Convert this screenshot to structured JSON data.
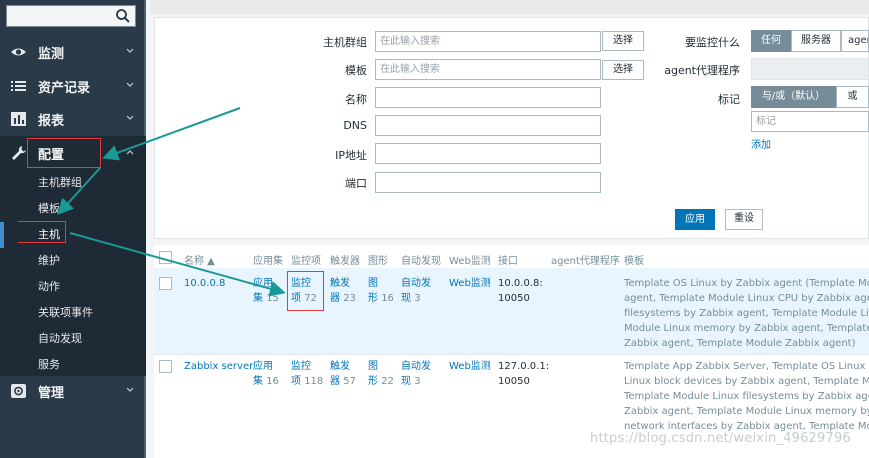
{
  "sidebar": {
    "search": {
      "value": "",
      "placeholder": ""
    },
    "menu": [
      {
        "label": "监测",
        "icon": "eye-icon"
      },
      {
        "label": "资产记录",
        "icon": "list-icon"
      },
      {
        "label": "报表",
        "icon": "bar-chart-icon"
      },
      {
        "label": "配置",
        "icon": "wrench-icon"
      },
      {
        "label": "管理",
        "icon": "gear-icon"
      }
    ],
    "config_submenu": [
      "主机群组",
      "模板",
      "主机",
      "维护",
      "动作",
      "关联项事件",
      "自动发现",
      "服务"
    ]
  },
  "filter": {
    "host_group_label": "主机群组",
    "host_group_placeholder": "在此输入搜索",
    "template_label": "模板",
    "template_placeholder": "在此输入搜索",
    "select_label": "选择",
    "name_label": "名称",
    "dns_label": "DNS",
    "ip_label": "IP地址",
    "port_label": "端口",
    "monitor_what_label": "要监控什么",
    "monitor_options": [
      "任何",
      "服务器",
      "agent"
    ],
    "agent_proxy_label": "agent代理程序",
    "tags_label": "标记",
    "tag_logic": [
      "与/或（默认）",
      "或"
    ],
    "tag_placeholder": "标记",
    "add_label": "添加",
    "apply_label": "应用",
    "reset_label": "重设"
  },
  "table": {
    "headers": {
      "name": "名称 ▲",
      "applications": "应用集",
      "items": "监控项",
      "triggers": "触发器",
      "graphs": "图形",
      "discovery": "自动发现",
      "web": "Web监测",
      "interface": "接口",
      "proxy": "agent代理程序",
      "templates": "模板"
    },
    "rows": [
      {
        "name": "10.0.0.8",
        "app_word1": "应用",
        "app_word2": "集",
        "app_count": "15",
        "items_word1": "监控",
        "items_word2": "项",
        "items_count": "72",
        "trig_word1": "触发",
        "trig_word2": "器",
        "trig_count": "23",
        "graph_word1": "图",
        "graph_word2": "形",
        "graph_count": "16",
        "disc_word1": "自动发",
        "disc_word2": "现",
        "disc_count": "3",
        "web": "Web监测",
        "iface_line1": "10.0.0.8:",
        "iface_line2": "10050",
        "templates": [
          "Template OS Linux by Zabbix agent (Template Module",
          "agent, Template Module Linux CPU by Zabbix agent, T",
          "filesystems by Zabbix agent, Template Module Linux ge",
          "Module Linux memory by Zabbix agent, Template Modu",
          "Zabbix agent, Template Module Zabbix agent)"
        ]
      },
      {
        "name": "Zabbix server",
        "app_word1": "应用",
        "app_word2": "集",
        "app_count": "16",
        "items_word1": "监控",
        "items_word2": "项",
        "items_count": "118",
        "trig_word1": "触发",
        "trig_word2": "器",
        "trig_count": "57",
        "graph_word1": "图",
        "graph_word2": "形",
        "graph_count": "22",
        "disc_word1": "自动发",
        "disc_word2": "现",
        "disc_count": "3",
        "web": "Web监测",
        "iface_line1": "127.0.0.1:",
        "iface_line2": "10050",
        "templates": [
          "Template App Zabbix Server, Template OS Linux by Za",
          "Linux block devices by Zabbix agent, Template Module",
          "Template Module Linux filesystems by Zabbix agent, Te",
          "Zabbix agent, Template Module Linux memory by Zabb",
          "network interfaces by Zabbix agent, Template Module Z"
        ]
      }
    ]
  },
  "watermark": "https://blog.csdn.net/weixin_49629796",
  "colors": {
    "sidebar_bg": "#2b3a48",
    "submenu_bg": "#1e2a35",
    "link": "#0275b8",
    "selected_row": "#e8f5ff",
    "annotation_red": "#e23b3b",
    "annotation_arrow": "#1a9a94"
  }
}
